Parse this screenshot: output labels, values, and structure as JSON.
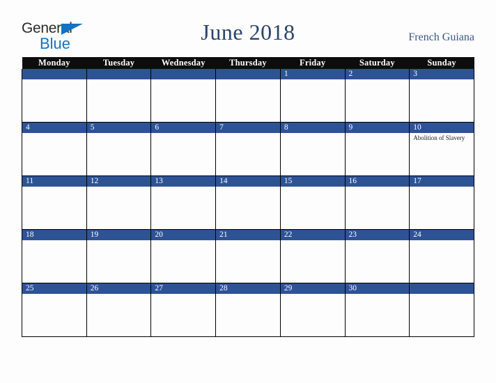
{
  "logo": {
    "line1": "General",
    "line2": "Blue",
    "triangle_icon": "blue-triangle-icon",
    "color_dark": "#2b2b2b",
    "color_blue": "#1272c4"
  },
  "header": {
    "title": "June 2018",
    "region": "French Guiana",
    "title_color": "#2b4469",
    "region_color": "#3c5580"
  },
  "colors": {
    "header_band": "#0d0d0d",
    "date_band": "#2e5395",
    "cell_background": "#fdfdfd",
    "grid_line": "#000000",
    "page_background": "#fdfdfd"
  },
  "calendar": {
    "weekday_headers": [
      "Monday",
      "Tuesday",
      "Wednesday",
      "Thursday",
      "Friday",
      "Saturday",
      "Sunday"
    ],
    "weeks": [
      [
        {
          "date": "",
          "events": []
        },
        {
          "date": "",
          "events": []
        },
        {
          "date": "",
          "events": []
        },
        {
          "date": "",
          "events": []
        },
        {
          "date": "1",
          "events": []
        },
        {
          "date": "2",
          "events": []
        },
        {
          "date": "3",
          "events": []
        }
      ],
      [
        {
          "date": "4",
          "events": []
        },
        {
          "date": "5",
          "events": []
        },
        {
          "date": "6",
          "events": []
        },
        {
          "date": "7",
          "events": []
        },
        {
          "date": "8",
          "events": []
        },
        {
          "date": "9",
          "events": []
        },
        {
          "date": "10",
          "events": [
            "Abolition of Slavery"
          ]
        }
      ],
      [
        {
          "date": "11",
          "events": []
        },
        {
          "date": "12",
          "events": []
        },
        {
          "date": "13",
          "events": []
        },
        {
          "date": "14",
          "events": []
        },
        {
          "date": "15",
          "events": []
        },
        {
          "date": "16",
          "events": []
        },
        {
          "date": "17",
          "events": []
        }
      ],
      [
        {
          "date": "18",
          "events": []
        },
        {
          "date": "19",
          "events": []
        },
        {
          "date": "20",
          "events": []
        },
        {
          "date": "21",
          "events": []
        },
        {
          "date": "22",
          "events": []
        },
        {
          "date": "23",
          "events": []
        },
        {
          "date": "24",
          "events": []
        }
      ],
      [
        {
          "date": "25",
          "events": []
        },
        {
          "date": "26",
          "events": []
        },
        {
          "date": "27",
          "events": []
        },
        {
          "date": "28",
          "events": []
        },
        {
          "date": "29",
          "events": []
        },
        {
          "date": "30",
          "events": []
        },
        {
          "date": "",
          "events": []
        }
      ]
    ]
  }
}
